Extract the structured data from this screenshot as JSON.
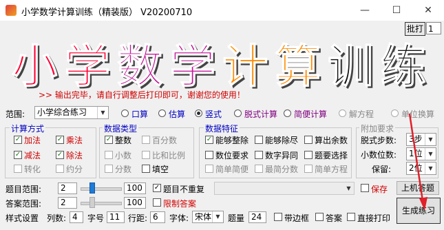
{
  "window": {
    "title": "小学数学计算训练（精装版） V20200710",
    "minimize": "—",
    "maximize": "☐",
    "close": "✕"
  },
  "banner": {
    "chars": [
      "小",
      "学",
      "数",
      "学",
      "计",
      "算",
      "训",
      "练"
    ],
    "char_colors": [
      "#ff0033",
      "#ff0033",
      "#c2189a",
      "#c2189a",
      "#ff8a00",
      "#ff8a00",
      "#111111",
      "#111111"
    ]
  },
  "print": {
    "button": "批打",
    "count": "1"
  },
  "message": ">> 输出完毕，请自行调整后打印即可，谢谢您的使用！",
  "range": {
    "label": "范围:",
    "selected": "小学综合练习",
    "options": [
      {
        "label": "口算",
        "checked": false,
        "disabled": false,
        "color": "#0000c0"
      },
      {
        "label": "估算",
        "checked": false,
        "disabled": false,
        "color": "#0000c0"
      },
      {
        "label": "竖式",
        "checked": true,
        "disabled": false,
        "color": "#0000c0"
      },
      {
        "label": "脱式计算",
        "checked": false,
        "disabled": false,
        "color": "#800080"
      },
      {
        "label": "简便计算",
        "checked": false,
        "disabled": false,
        "color": "#800080"
      },
      {
        "label": "解方程",
        "checked": false,
        "disabled": true,
        "color": "#888888"
      },
      {
        "label": "单位换算",
        "checked": false,
        "disabled": true,
        "color": "#888888"
      }
    ]
  },
  "calc_method": {
    "title": "计算方式",
    "items": [
      {
        "label": "加法",
        "checked": true,
        "color": "#d00000"
      },
      {
        "label": "乘法",
        "checked": true,
        "color": "#d00000"
      },
      {
        "label": "减法",
        "checked": true,
        "color": "#d00000"
      },
      {
        "label": "除法",
        "checked": true,
        "color": "#d00000"
      },
      {
        "label": "转化",
        "checked": false,
        "color": "#888888"
      },
      {
        "label": "约分",
        "checked": false,
        "color": "#888888"
      }
    ]
  },
  "data_type": {
    "title": "数据类型",
    "items": [
      {
        "label": "整数",
        "checked": true,
        "color": "#000000"
      },
      {
        "label": "百分数",
        "checked": false,
        "color": "#888888"
      },
      {
        "label": "小数",
        "checked": false,
        "color": "#888888"
      },
      {
        "label": "比和比例",
        "checked": false,
        "color": "#888888"
      },
      {
        "label": "分数",
        "checked": false,
        "color": "#888888"
      },
      {
        "label": "填空",
        "checked": false,
        "color": "#000000"
      }
    ]
  },
  "data_feature": {
    "title": "数据特征",
    "items": [
      {
        "label": "能够整除",
        "checked": true,
        "color": "#000000"
      },
      {
        "label": "能够除尽",
        "checked": false,
        "color": "#000000"
      },
      {
        "label": "算出余数",
        "checked": false,
        "color": "#000000"
      },
      {
        "label": "数位要求",
        "checked": false,
        "color": "#000000"
      },
      {
        "label": "数字异同",
        "checked": false,
        "color": "#000000"
      },
      {
        "label": "题要选择",
        "checked": false,
        "color": "#000000"
      },
      {
        "label": "简单简便",
        "checked": false,
        "color": "#888888"
      },
      {
        "label": "最简分数",
        "checked": false,
        "color": "#888888"
      },
      {
        "label": "简单方程",
        "checked": false,
        "color": "#888888"
      }
    ]
  },
  "extra": {
    "title": "附加要求",
    "rows": [
      {
        "label": "脱式步数:",
        "value": "3步"
      },
      {
        "label": "小数位数:",
        "value": "1位"
      },
      {
        "label": "保留:",
        "value": "2位"
      }
    ]
  },
  "question_range": {
    "label": "题目范围:",
    "min": "2",
    "max": "100",
    "level": 0.25,
    "nodup_label": "题目不重复",
    "nodup_checked": true
  },
  "answer_range": {
    "label": "答案范围:",
    "min": "2",
    "max": "100",
    "level": 0.25,
    "limit_label": "限制答案",
    "limit_checked": false
  },
  "save": {
    "label": "保存",
    "checked": false
  },
  "practice_button": "上机答题",
  "generate_button": "生成练习",
  "style": {
    "label": "样式设置",
    "cols_label": "列数:",
    "cols": "4",
    "size_label": "字号",
    "size": "11",
    "line_label": "行距:",
    "line": "6",
    "font_label": "字体:",
    "font": "宋体",
    "count_label": "题量",
    "count": "24",
    "border_label": "带边框",
    "answer_label": "答案",
    "direct_print_label": "直接打印"
  },
  "colors": {
    "accent": "#1e7bd8",
    "red": "#d00000",
    "arrow": "#e0202a"
  }
}
